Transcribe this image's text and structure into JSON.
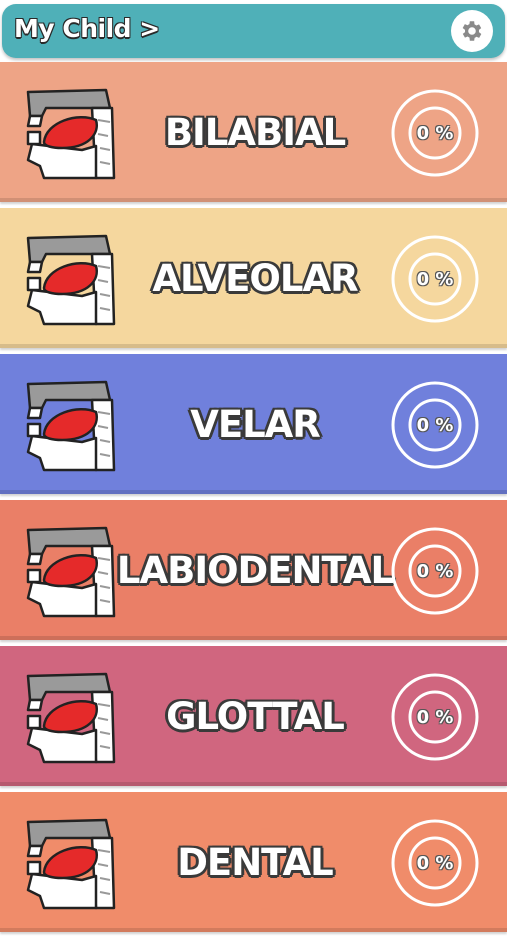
{
  "header": {
    "title": "My Child >",
    "settings_icon": "gear-icon"
  },
  "categories": [
    {
      "label": "BILABIAL",
      "progress": "0 %",
      "color": "#eea486",
      "icon": "mouth-profile-icon"
    },
    {
      "label": "ALVEOLAR",
      "progress": "0 %",
      "color": "#f5d79e",
      "icon": "mouth-profile-icon"
    },
    {
      "label": "VELAR",
      "progress": "0 %",
      "color": "#7080dc",
      "icon": "mouth-profile-icon"
    },
    {
      "label": "LABIODENTAL",
      "progress": "0 %",
      "color": "#ea7f67",
      "icon": "mouth-profile-icon"
    },
    {
      "label": "GLOTTAL",
      "progress": "0 %",
      "color": "#d0667f",
      "icon": "mouth-profile-icon"
    },
    {
      "label": "DENTAL",
      "progress": "0 %",
      "color": "#f08c6a",
      "icon": "mouth-profile-icon"
    }
  ],
  "colors": {
    "header": "#4fb0b8",
    "tongue": "#e52a2a",
    "palate": "#9a9a9a"
  }
}
